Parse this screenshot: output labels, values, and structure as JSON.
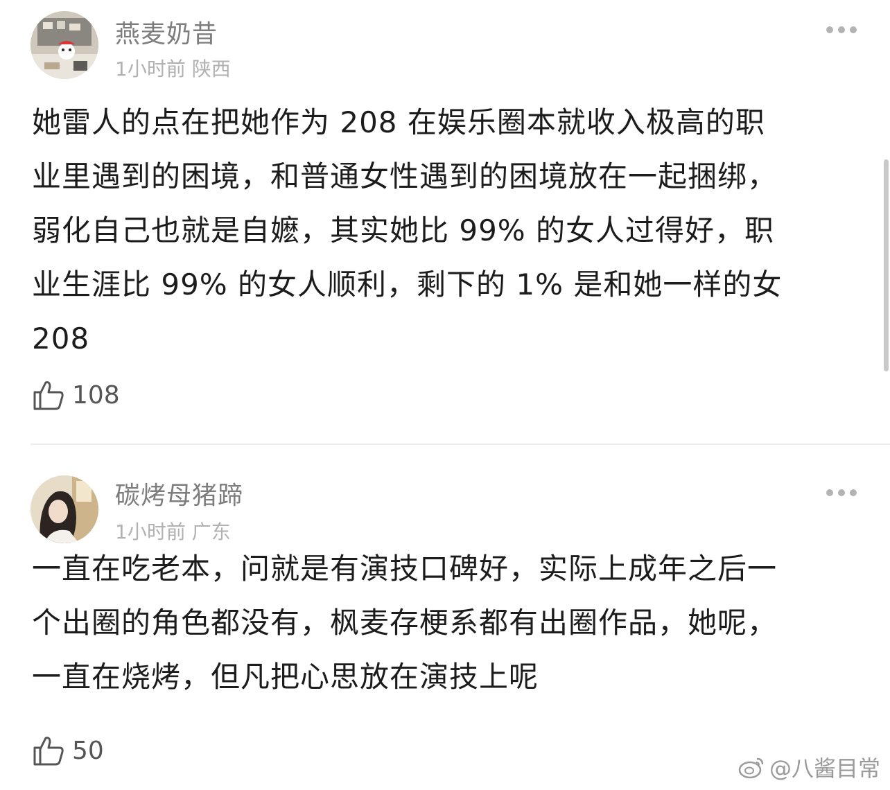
{
  "comments": [
    {
      "username": "燕麦奶昔",
      "time": "1小时前",
      "location": "陕西",
      "text": "她雷人的点在把她作为 208 在娱乐圈本就收入极高的职\n业里遇到的困境，和普通女性遇到的困境放在一起捆绑，\n弱化自己也就是自嬷，其实她比 99% 的女人过得好，职\n业生涯比 99% 的女人顺利，剩下的 1% 是和她一样的女\n 208",
      "likes": "108",
      "avatar_icon": "avatar-photo-cartoon-desk"
    },
    {
      "username": "碳烤母猪蹄",
      "time": "1小时前",
      "location": "广东",
      "text": "一直在吃老本，问就是有演技口碑好，实际上成年之后一\n个出圈的角色都没有，枫麦存梗系都有出圈作品，她呢，\n一直在烧烤，但凡把心思放在演技上呢",
      "likes": "50",
      "avatar_icon": "avatar-photo-woman"
    }
  ],
  "watermark": {
    "text": "@八酱目常",
    "icon": "weibo-icon"
  },
  "colors": {
    "username": "#7d7d7d",
    "meta": "#b1b1b1",
    "text": "#1c1c1c",
    "divider": "#ececec"
  }
}
